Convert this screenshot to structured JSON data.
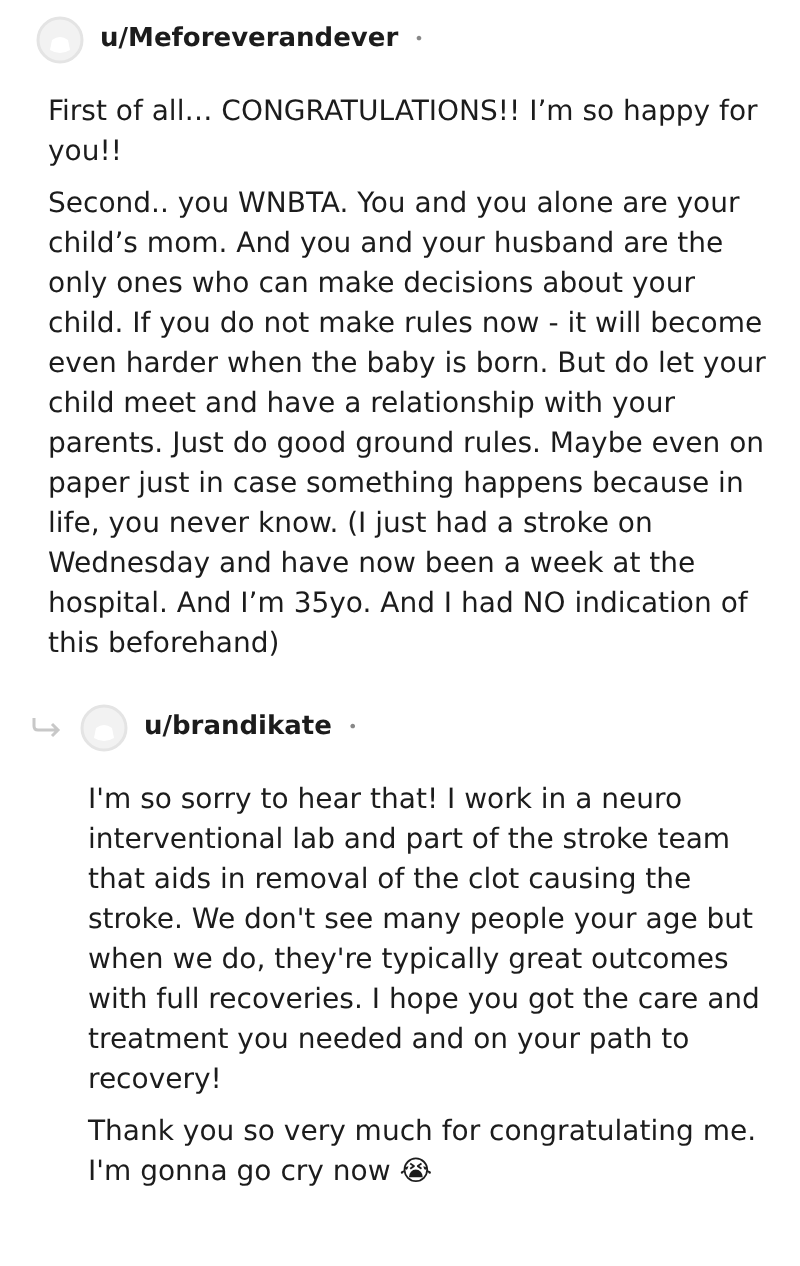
{
  "comments": [
    {
      "author": "u/Meforeverandever",
      "separator": "•",
      "is_reply": false,
      "paragraphs": [
        "First of all… CONGRATULATIONS!! I’m so happy for you!!",
        "Second.. you WNBTA. You and you alone are your child’s mom. And you and your husband are the only ones who can make decisions about your child. If you do not make rules now - it will become even harder when the baby is born. But do let your child meet and have a relationship with your parents. Just do good ground rules. Maybe even on paper just in case something happens because in life, you never know. (I just had a stroke on Wednesday and have now been a week at the hospital. And I’m 35yo. And I had NO indication of this beforehand)"
      ]
    },
    {
      "author": "u/brandikate",
      "separator": "•",
      "is_reply": true,
      "paragraphs": [
        "I'm so sorry to hear that! I work in a neuro interventional lab and part of the stroke team that aids in removal of the clot causing the stroke. We don't see many people your age but when we do, they're typically great outcomes with full recoveries. I hope you got the care and treatment you needed and on your path to recovery!",
        "Thank you so very much for congratulating me. I'm gonna go cry now 😭"
      ]
    }
  ]
}
